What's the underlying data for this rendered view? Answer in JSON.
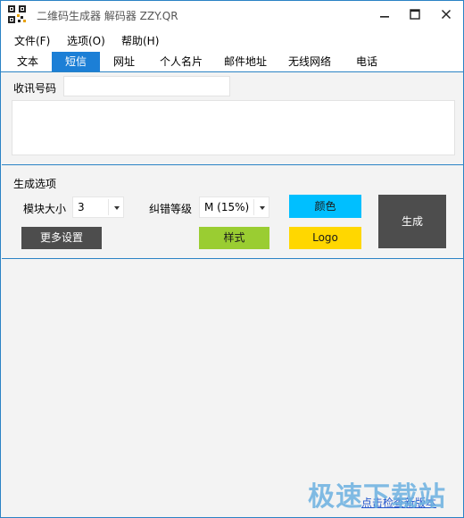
{
  "window": {
    "title": "二维码生成器 解码器 ZZY.QR"
  },
  "menu": [
    "文件(F)",
    "选项(O)",
    "帮助(H)"
  ],
  "tabs": [
    {
      "label": "文本",
      "active": false
    },
    {
      "label": "短信",
      "active": true
    },
    {
      "label": "网址",
      "active": false
    },
    {
      "label": "个人名片",
      "active": false
    },
    {
      "label": "邮件地址",
      "active": false
    },
    {
      "label": "无线网络",
      "active": false
    },
    {
      "label": "电话",
      "active": false
    }
  ],
  "sms": {
    "phone_label": "收讯号码",
    "phone_value": "",
    "message_value": ""
  },
  "options": {
    "section_title": "生成选项",
    "module_size_label": "模块大小",
    "module_size_value": "3",
    "ecc_label": "纠错等级",
    "ecc_value": "M (15%)",
    "color_button": "颜色",
    "style_button": "样式",
    "logo_button": "Logo",
    "more_button": "更多设置",
    "generate_button": "生成"
  },
  "colors": {
    "accent": "#1c7fd6",
    "color_btn": "#00bfff",
    "style_btn": "#9acd32",
    "logo_btn": "#ffd700",
    "dark_btn": "#4d4d4d"
  },
  "footer": {
    "watermark": "极速下载站",
    "link": "点击检查新版本"
  }
}
